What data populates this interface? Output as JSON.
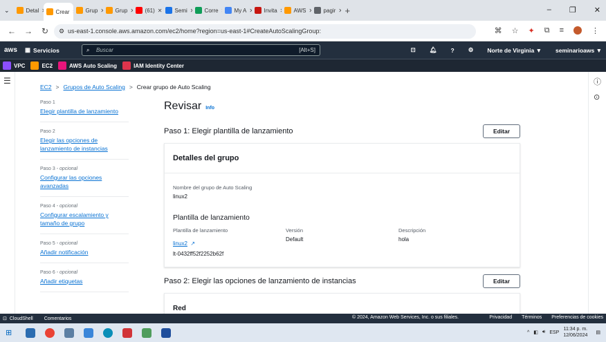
{
  "browser": {
    "tabs": [
      {
        "label": "Detal",
        "color": "#ff9900"
      },
      {
        "label": "Crear",
        "color": "#ff9900",
        "active": true
      },
      {
        "label": "Grup",
        "color": "#ff9900"
      },
      {
        "label": "Grup",
        "color": "#ff9900"
      },
      {
        "label": "(61)",
        "color": "#ff0000"
      },
      {
        "label": "Semi",
        "color": "#1a73e8"
      },
      {
        "label": "Corre",
        "color": "#0f9d58"
      },
      {
        "label": "My A",
        "color": "#4285f4"
      },
      {
        "label": "Invita",
        "color": "#c71610"
      },
      {
        "label": "AWS",
        "color": "#ff9900"
      },
      {
        "label": "pagir",
        "color": "#5f6368"
      }
    ],
    "url": "us-east-1.console.aws.amazon.com/ec2/home?region=us-east-1#CreateAutoScalingGroup:"
  },
  "aws": {
    "logo": "aws",
    "services_label": "Servicios",
    "search_placeholder": "Buscar",
    "search_shortcut": "[Alt+S]",
    "region": "Norte de Virginia ▼",
    "account": "seminarioaws ▼"
  },
  "favorites": [
    {
      "label": "VPC",
      "color": "#8c4fff"
    },
    {
      "label": "EC2",
      "color": "#ff9900"
    },
    {
      "label": "AWS Auto Scaling",
      "color": "#e7157b"
    },
    {
      "label": "IAM Identity Center",
      "color": "#dd344c"
    }
  ],
  "breadcrumb": {
    "ec2": "EC2",
    "groups": "Grupos de Auto Scaling",
    "current": "Crear grupo de Auto Scaling"
  },
  "steps": [
    {
      "num": "Paso 1",
      "optional": "",
      "label": "Elegir plantilla de lanzamiento",
      "current": false
    },
    {
      "num": "Paso 2",
      "optional": "",
      "label": "Elegir las opciones de lanzamiento de instancias",
      "current": false
    },
    {
      "num": "Paso 3",
      "optional": " - opcional",
      "label": "Configurar las opciones avanzadas",
      "current": false
    },
    {
      "num": "Paso 4",
      "optional": " - opcional",
      "label": "Configurar escalamiento y tamaño de grupo",
      "current": false
    },
    {
      "num": "Paso 5",
      "optional": " - opcional",
      "label": "Añadir notificación",
      "current": false
    },
    {
      "num": "Paso 6",
      "optional": " - opcional",
      "label": "Añadir etiquetas",
      "current": false
    }
  ],
  "main": {
    "title": "Revisar",
    "info": "Info",
    "step1_title": "Paso 1: Elegir plantilla de lanzamiento",
    "edit": "Editar",
    "group_details": "Detalles del grupo",
    "asg_name_label": "Nombre del grupo de Auto Scaling",
    "asg_name": "linux2",
    "lt_section": "Plantilla de lanzamiento",
    "lt_label": "Plantilla de lanzamiento",
    "lt_name": "linux2",
    "lt_id": "lt-0432ff52f2252b62f",
    "version_label": "Versión",
    "version": "Default",
    "desc_label": "Descripción",
    "desc": "hola",
    "step2_title": "Paso 2: Elegir las opciones de lanzamiento de instancias",
    "red": "Red"
  },
  "footer": {
    "cloudshell": "CloudShell",
    "comments": "Comentarios",
    "copyright": "© 2024, Amazon Web Services, Inc. o sus filiales.",
    "privacy": "Privacidad",
    "terms": "Términos",
    "cookies": "Preferencias de cookies"
  },
  "taskbar": {
    "lang": "ESP",
    "time": "11:34 p. m.",
    "date": "12/06/2024"
  }
}
